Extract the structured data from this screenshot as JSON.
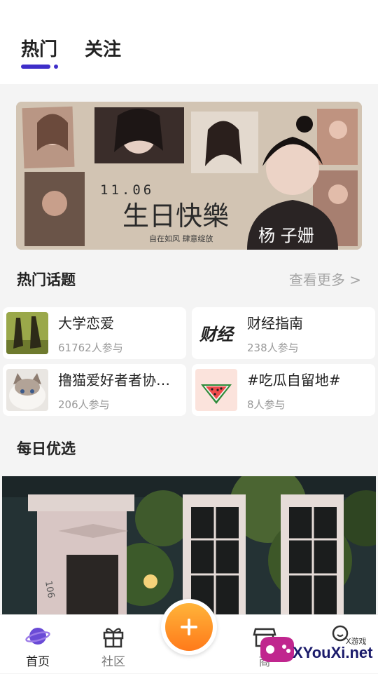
{
  "tabs": [
    {
      "label": "热门",
      "active": true
    },
    {
      "label": "关注",
      "active": false
    }
  ],
  "banner": {
    "date": "11.06",
    "headline": "生日快樂",
    "slogan": "自在如风    肆意绽放",
    "name": "杨 子姗"
  },
  "hot_topics": {
    "title": "热门话题",
    "more": "查看更多 >",
    "items": [
      {
        "name": "大学恋爱",
        "count": "61762人参与",
        "thumb": "couple-silhouette-photo"
      },
      {
        "name": "财经指南",
        "count": "238人参与",
        "thumb": "finance-logo-text"
      },
      {
        "name": "撸猫爱好者者协…",
        "count": "206人参与",
        "thumb": "cat-photo"
      },
      {
        "name": "#吃瓜自留地#",
        "count": "8人参与",
        "thumb": "watermelon-icon"
      }
    ],
    "finance_logo_text": "财经"
  },
  "daily": {
    "title": "每日优选",
    "door_number": "106"
  },
  "nav": {
    "items": [
      {
        "label": "首页",
        "icon": "planet-icon",
        "active": true
      },
      {
        "label": "社区",
        "icon": "gift-icon",
        "active": false
      },
      {
        "label": "商",
        "icon": "shop-icon",
        "active": false
      },
      {
        "label": "",
        "icon": "bubble-icon",
        "active": false
      }
    ],
    "fab_icon": "plus-icon"
  },
  "watermark": {
    "text": "XYouXi.net",
    "small": "X游戏"
  },
  "colors": {
    "accent": "#3e2ec9",
    "fab": "#ff9a2a"
  }
}
